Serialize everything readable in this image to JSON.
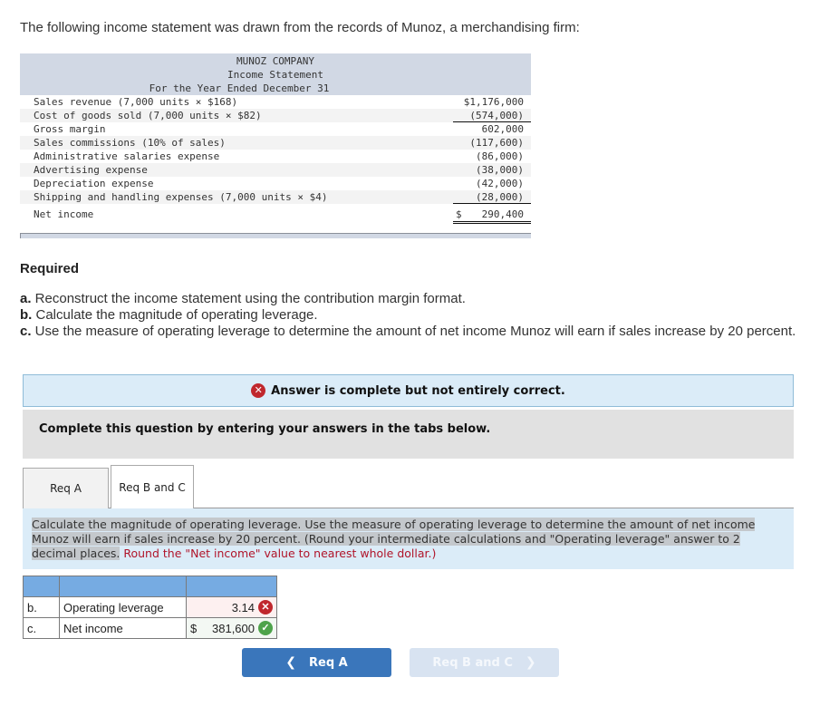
{
  "intro": "The following income statement was drawn from the records of Munoz, a merchandising firm:",
  "statement": {
    "company": "MUNOZ COMPANY",
    "title": "Income Statement",
    "period": "For the Year Ended December 31",
    "rows": [
      {
        "label": "Sales revenue (7,000 units × $168)",
        "amount": "$1,176,000"
      },
      {
        "label": "Cost of goods sold (7,000 units × $82)",
        "amount": "(574,000)"
      },
      {
        "label": "Gross margin",
        "amount": "602,000"
      },
      {
        "label": "Sales commissions (10% of sales)",
        "amount": "(117,600)"
      },
      {
        "label": "Administrative salaries expense",
        "amount": "(86,000)"
      },
      {
        "label": "Advertising expense",
        "amount": "(38,000)"
      },
      {
        "label": "Depreciation expense",
        "amount": "(42,000)"
      },
      {
        "label": "Shipping and handling expenses (7,000 units × $4)",
        "amount": "(28,000)"
      }
    ],
    "net": {
      "label": "Net income",
      "currency": "$",
      "amount": "290,400"
    }
  },
  "required": {
    "heading": "Required",
    "items": [
      {
        "letter": "a.",
        "text": " Reconstruct the income statement using the contribution margin format."
      },
      {
        "letter": "b.",
        "text": " Calculate the magnitude of operating leverage."
      },
      {
        "letter": "c.",
        "text": " Use the measure of operating leverage to determine the amount of net income Munoz will earn if sales increase by 20 percent."
      }
    ]
  },
  "alert": "Answer is complete but not entirely correct.",
  "instruction": "Complete this question by entering your answers in the tabs below.",
  "tabs": [
    {
      "label": "Req A"
    },
    {
      "label": "Req B and C"
    }
  ],
  "question": {
    "highlighted": "Calculate the magnitude of operating leverage. Use the measure of operating leverage to determine the amount of net income Munoz will earn if sales increase by 20 percent. (Round your intermediate calculations and \"Operating leverage\" answer to 2 decimal places.",
    "red": " Round the \"Net income\" value to nearest whole dollar.)"
  },
  "answers": [
    {
      "letter": "b.",
      "label": "Operating leverage",
      "currency": "",
      "value": "3.14",
      "status": "incorrect"
    },
    {
      "letter": "c.",
      "label": "Net income",
      "currency": "$",
      "value": "381,600",
      "status": "correct"
    }
  ],
  "nav": {
    "prev_label": "Req A",
    "next_label": "Req B and C"
  },
  "colors": {
    "primary": "#3a76bb",
    "incorrect": "#c0272d",
    "correct": "#4ea34b",
    "table_header": "#76abe2"
  }
}
